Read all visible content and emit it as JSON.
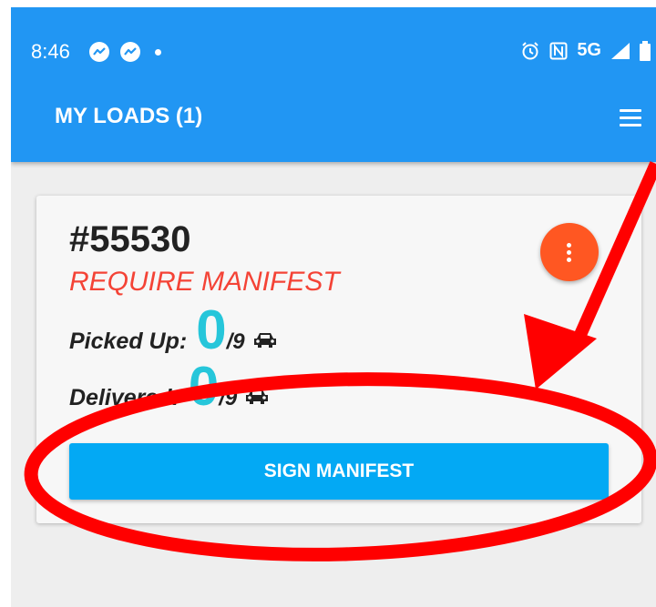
{
  "status_bar": {
    "time": "8:46",
    "network": "5G",
    "left_icons": [
      "messenger-icon",
      "messenger-icon",
      "notification-dot-icon"
    ],
    "right_icons": [
      "alarm-icon",
      "nfc-icon",
      "signal-icon",
      "battery-icon"
    ]
  },
  "app_bar": {
    "title": "MY LOADS (1)",
    "menu_icon": "hamburger-menu-icon",
    "color": "#2196f3"
  },
  "load_card": {
    "id": "#55530",
    "status": "REQUIRE MANIFEST",
    "status_color": "#f44336",
    "picked_up": {
      "label": "Picked Up:",
      "count": "0",
      "total": "/9",
      "icon": "car-icon"
    },
    "delivered": {
      "label": "Delivered:",
      "count": "0",
      "total": "/9",
      "icon": "car-icon"
    },
    "more_button_icon": "more-vertical-icon",
    "more_button_color": "#ff5722",
    "sign_button_label": "SIGN MANIFEST",
    "sign_button_color": "#03a9f4"
  },
  "annotation": {
    "color": "#ff0000",
    "shapes": [
      "arrow",
      "ellipse"
    ]
  }
}
